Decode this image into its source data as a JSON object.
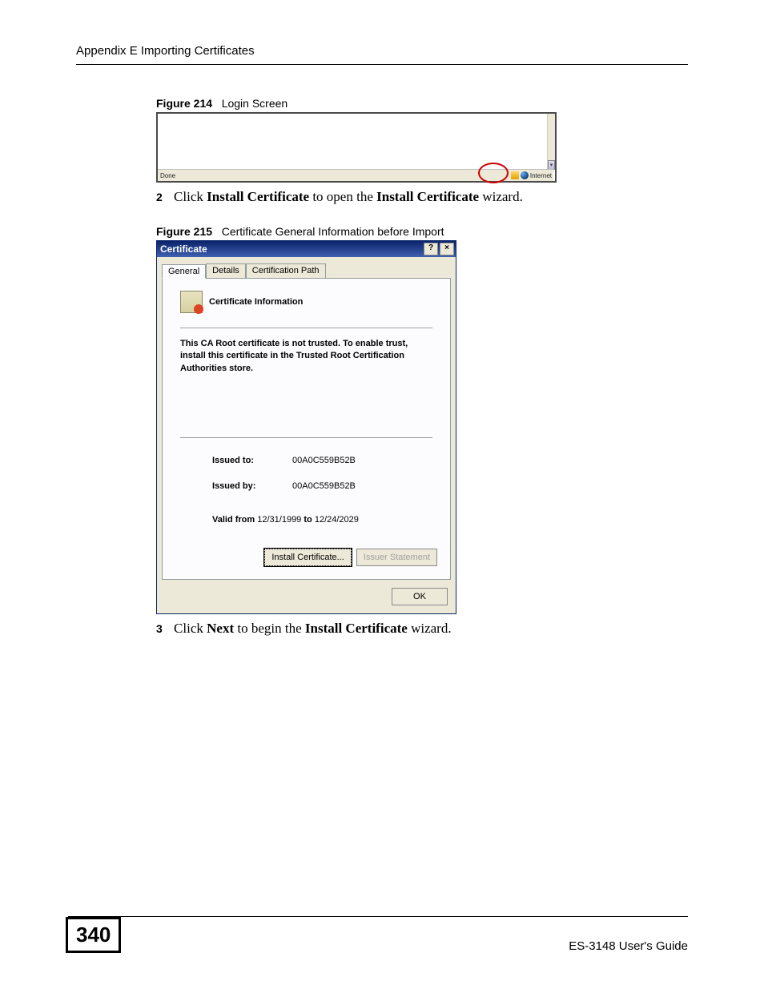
{
  "header": {
    "appendix_title": "Appendix E Importing Certificates"
  },
  "figure214": {
    "caption_bold": "Figure 214",
    "caption_text": "Login Screen",
    "status_done": "Done",
    "status_internet": "Internet"
  },
  "step2": {
    "num": "2",
    "pre": "Click ",
    "b1": "Install Certificate",
    "mid": " to open the ",
    "b2": "Install Certificate",
    "post": " wizard."
  },
  "figure215": {
    "caption_bold": "Figure 215",
    "caption_text": "Certificate General Information before Import"
  },
  "cert": {
    "title": "Certificate",
    "help_btn": "?",
    "close_btn": "×",
    "tabs": {
      "general": "General",
      "details": "Details",
      "path": "Certification Path"
    },
    "info_title": "Certificate Information",
    "message": "This CA Root certificate is not trusted. To enable trust, install this certificate in the Trusted Root Certification Authorities store.",
    "issued_to_label": "Issued to:",
    "issued_to_value": "00A0C559B52B",
    "issued_by_label": "Issued by:",
    "issued_by_value": "00A0C559B52B",
    "valid_label": "Valid from",
    "valid_from": "12/31/1999",
    "valid_to_word": "to",
    "valid_to": "12/24/2029",
    "btn_install": "Install Certificate...",
    "btn_issuer": "Issuer Statement",
    "btn_ok": "OK"
  },
  "step3": {
    "num": "3",
    "pre": "Click ",
    "b1": "Next",
    "mid": " to begin the ",
    "b2": "Install Certificate",
    "post": " wizard."
  },
  "footer": {
    "page_number": "340",
    "guide": "ES-3148 User's Guide"
  }
}
